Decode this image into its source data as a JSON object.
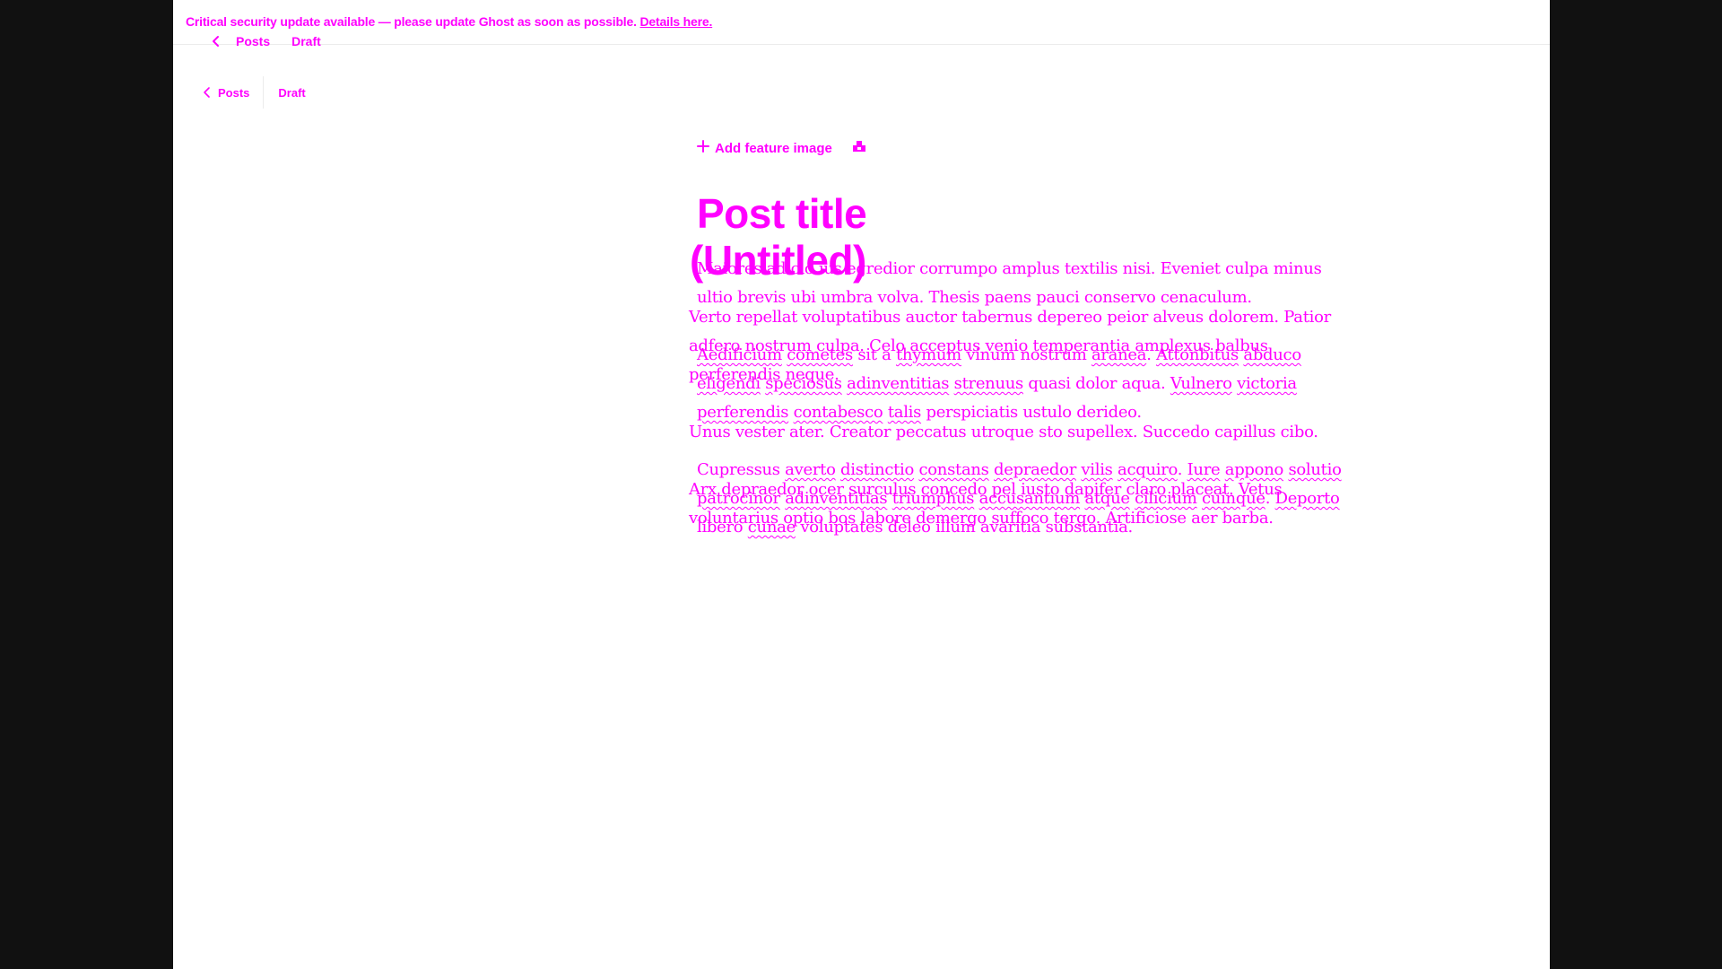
{
  "banner": {
    "message": "Critical security update available — please update Ghost as soon as possible.",
    "link_label": "Details here."
  },
  "breadcrumb": {
    "back_label": "Posts",
    "status_label": "Draft"
  },
  "editor": {
    "add_feature_image_label": "Add feature image",
    "title_placeholder": "Post title",
    "title_value": "(Untitled)",
    "body_layer_a": {
      "p1": "Maiores adicio ius egredior corrumpo amplus textilis nisi. Eveniet culpa minus ultio brevis ubi umbra volva. Thesis paens pauci conservo cenaculum.",
      "p2": {
        "w1": "Aedificium",
        "w2": "cometes",
        "t1": " sit a ",
        "w3": "thymum",
        "t2": " vinum nostrum ",
        "w4": "aranea",
        "t3": ". ",
        "w5": "Attonbitus",
        "t4": " ",
        "w6": "abduco",
        "t5": " ",
        "w7": "eligendi",
        "t6": " ",
        "w8": "speciosus",
        "t7": " ",
        "w9": "adinventitias",
        "t8": " ",
        "w10": "strenuus",
        "t9": " quasi dolor aqua. ",
        "w11": "Vulnero",
        "t10": " ",
        "w12": "victoria",
        "t11": " ",
        "w13": "perferendis",
        "t12": " ",
        "w14": "contabesco",
        "t13": " ",
        "w15": "talis",
        "t14": " perspiciatis ustulo derideo."
      },
      "p3": {
        "t1": "Cupressus ",
        "w1": "averto",
        "t2": " ",
        "w2": "distinctio",
        "t3": " ",
        "w3": "constans",
        "t4": " ",
        "w4": "depraedor",
        "t5": " ",
        "w5": "vilis",
        "t6": " ",
        "w6": "acquiro",
        "t7": ". ",
        "w7": "Iure",
        "t8": " ",
        "w8": "appono",
        "t9": " ",
        "w9": "solutio",
        "t10": " ",
        "w10": "patrocinor",
        "t11": " ",
        "w11": "adinventitias",
        "t12": " ",
        "w12": "triumphus",
        "t13": " ",
        "w13": "accusantium",
        "t14": " ",
        "w14": "atque",
        "t15": " ",
        "w15": "cilicium",
        "t16": " ",
        "w16": "cuinque",
        "t17": ". ",
        "w17": "Deporto",
        "t18": " libero ",
        "w18": "cunae",
        "t19": " voluptates deleo illum avaritia substantia."
      }
    },
    "body_layer_b": {
      "p1": "Verto repellat voluptatibus auctor tabernus depereo peior alveus dolorem. Patior adfero nostrum culpa. Celo acceptus venio temperantia amplexus balbus perferendis neque.",
      "p2": "Unus vester ater. Creator peccatus utroque sto supellex. Succedo capillus cibo.",
      "p3": "Arx depraedor ocer surculus concedo pel iusto dapifer claro placeat. Vetus voluntarius optio bos labore demergo suffoco tergo. Artificiose aer barba."
    }
  },
  "colors": {
    "text": "#ff00ff",
    "background": "#ffffff",
    "backdrop": "#111111",
    "divider": "#ececec"
  },
  "icons": {
    "back": "chevron-left-icon",
    "add": "plus-icon",
    "image": "image-upload-icon"
  }
}
